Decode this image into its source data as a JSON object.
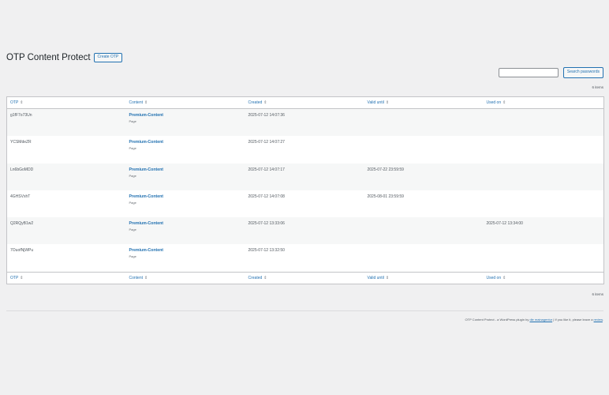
{
  "header": {
    "title": "OTP Content Protect",
    "create_label": "Create OTP"
  },
  "search": {
    "value": "",
    "placeholder": "",
    "button_label": "Search passwords"
  },
  "pagination": {
    "items_label": "6 items"
  },
  "table": {
    "columns": [
      "OTP",
      "Content",
      "Created",
      "Valid until",
      "Used on"
    ],
    "sort_icon": "sort-icon",
    "rows": [
      {
        "otp": "g1fF7o73Un",
        "content": "Premium-Content",
        "type": "Page",
        "created": "2025-07-12 14:07:36",
        "valid_until": "",
        "used_on": ""
      },
      {
        "otp": "YCSMdeZR",
        "content": "Premium-Content",
        "type": "Page",
        "created": "2025-07-12 14:07:27",
        "valid_until": "",
        "used_on": ""
      },
      {
        "otp": "Ln6bGoMDD",
        "content": "Premium-Content",
        "type": "Page",
        "created": "2025-07-12 14:07:17",
        "valid_until": "2025-07-22 23:59:59",
        "used_on": ""
      },
      {
        "otp": "4GHSVxhT",
        "content": "Premium-Content",
        "type": "Page",
        "created": "2025-07-12 14:07:08",
        "valid_until": "2025-08-01 23:59:59",
        "used_on": ""
      },
      {
        "otp": "Q2RQyB1w2",
        "content": "Premium-Content",
        "type": "Page",
        "created": "2025-07-12 13:33:06",
        "valid_until": "",
        "used_on": "2025-07-12 13:34:00"
      },
      {
        "otp": "7OuofNjWPu",
        "content": "Premium-Content",
        "type": "Page",
        "created": "2025-07-12 13:32:50",
        "valid_until": "",
        "used_on": ""
      }
    ]
  },
  "footer": {
    "prefix": "OTP Content Protect - a WordPress plugin by ",
    "author_link": "die mainagentur",
    "middle": " | If you like it, please leave a ",
    "review_link": "review",
    "suffix": "."
  },
  "colors": {
    "link": "#2271b1",
    "background": "#f0f0f1",
    "border": "#c3c4c7"
  }
}
